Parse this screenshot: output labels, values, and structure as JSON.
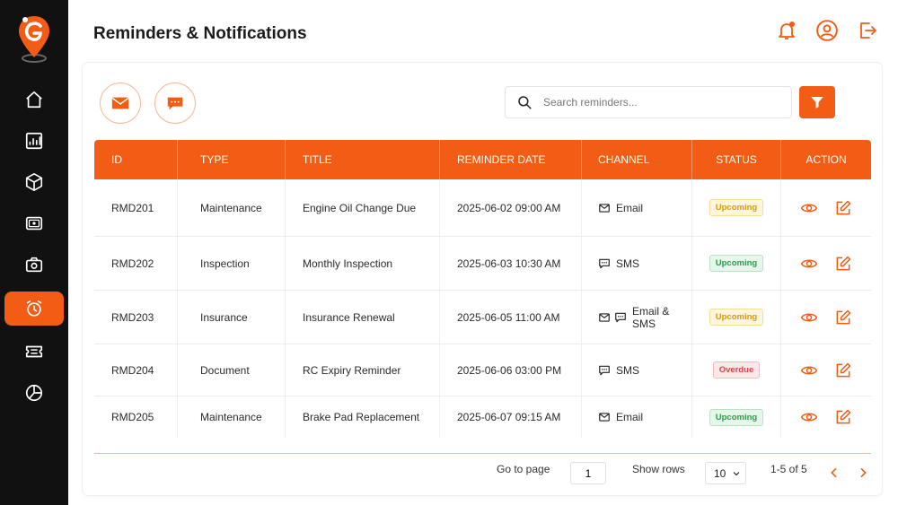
{
  "header": {
    "title": "Reminders & Notifications",
    "icons": [
      "bell-icon",
      "user-circle-icon",
      "logout-icon"
    ]
  },
  "sidebar": {
    "items": [
      {
        "icon": "home-icon",
        "active": false
      },
      {
        "icon": "analytics-icon",
        "active": false
      },
      {
        "icon": "box-icon",
        "active": false
      },
      {
        "icon": "wallet-icon",
        "active": false
      },
      {
        "icon": "camera-icon",
        "active": false
      },
      {
        "icon": "alarm-clock-icon",
        "active": true
      },
      {
        "icon": "ticket-icon",
        "active": false
      },
      {
        "icon": "pie-chart-icon",
        "active": false
      }
    ]
  },
  "toolbar": {
    "email_icon": "mail-icon",
    "sms_icon": "chat-icon",
    "search_placeholder": "Search reminders...",
    "filter_icon": "filter-icon"
  },
  "table": {
    "columns": [
      "ID",
      "TYPE",
      "TITLE",
      "REMINDER DATE",
      "CHANNEL",
      "STATUS",
      "ACTION"
    ],
    "rows": [
      {
        "id": "RMD201",
        "type": "Maintenance",
        "title": "Engine Oil Change Due",
        "date": "2025-06-02 09:00 AM",
        "channel": "Email",
        "status": "Upcoming"
      },
      {
        "id": "RMD202",
        "type": "Inspection",
        "title": "Monthly Inspection",
        "date": "2025-06-03 10:30 AM",
        "channel": "SMS",
        "status": "Upcoming"
      },
      {
        "id": "RMD203",
        "type": "Insurance",
        "title": "Insurance Renewal",
        "date": "2025-06-05 11:00 AM",
        "channel": "Email & SMS",
        "status": "Upcoming"
      },
      {
        "id": "RMD204",
        "type": "Document",
        "title": "RC Expiry Reminder",
        "date": "2025-06-06 03:00 PM",
        "channel": "SMS",
        "status": "Overdue"
      },
      {
        "id": "RMD205",
        "type": "Maintenance",
        "title": "Brake Pad Replacement",
        "date": "2025-06-07 09:15 AM",
        "channel": "Email",
        "status": "Upcoming"
      }
    ]
  },
  "pagination": {
    "go_to_page_label": "Go to page",
    "page_value": "1",
    "show_rows_label": "Show rows",
    "rows_value": "10",
    "range_text": "1-5 of 5"
  },
  "colors": {
    "accent": "#f25c14",
    "sidebar_bg": "#111111",
    "badge_yellow": "#d89a12",
    "badge_green": "#2f9a4c",
    "badge_red": "#d64545"
  }
}
